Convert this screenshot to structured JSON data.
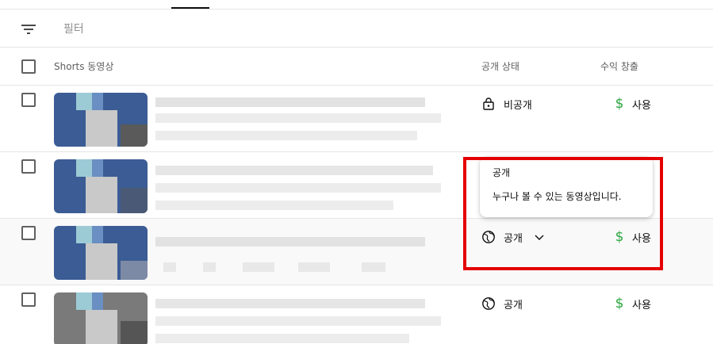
{
  "filter": {
    "label": "필터"
  },
  "table": {
    "headers": {
      "video": "Shorts 동영상",
      "visibility": "공개 상태",
      "monetization": "수익 창출"
    },
    "rows": [
      {
        "visibility": "비공개",
        "visibility_icon": "lock-icon",
        "monetization": "사용",
        "monetization_icon": "dollar-icon"
      },
      {
        "visibility": "",
        "visibility_icon": "",
        "monetization": "",
        "monetization_icon": ""
      },
      {
        "visibility": "공개",
        "visibility_icon": "globe-icon",
        "monetization": "사용",
        "monetization_icon": "dollar-icon",
        "hovered": true,
        "dropdown": "chevron-down-icon"
      },
      {
        "visibility": "공개",
        "visibility_icon": "globe-icon",
        "monetization": "사용",
        "monetization_icon": "dollar-icon"
      }
    ]
  },
  "tooltip": {
    "title": "공개",
    "description": "누구나 볼 수 있는 동영상입니다."
  },
  "colors": {
    "monetization_accent": "#2ba640",
    "highlight_box": "#e50000"
  }
}
